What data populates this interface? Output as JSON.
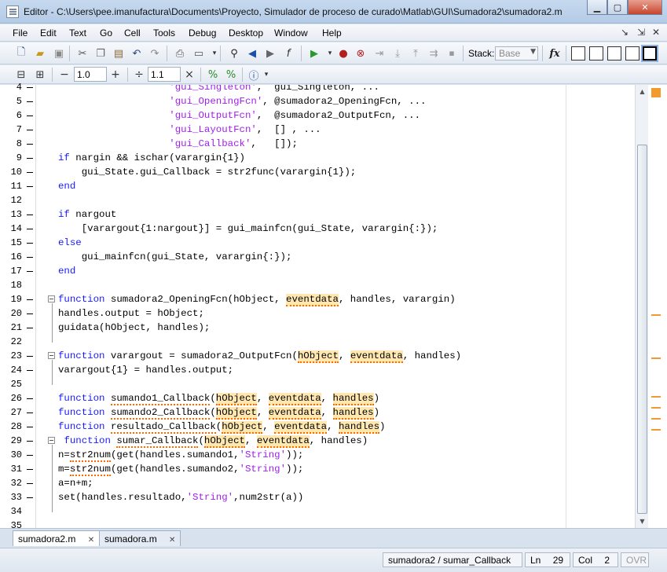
{
  "window": {
    "title": "Editor - C:\\Users\\pee.imanufactura\\Documents\\Proyecto, Simulador de proceso de curado\\Matlab\\GUI\\Sumadora2\\sumadora2.m"
  },
  "menu": [
    "File",
    "Edit",
    "Text",
    "Go",
    "Cell",
    "Tools",
    "Debug",
    "Desktop",
    "Window",
    "Help"
  ],
  "toolbar": {
    "stack_label": "Stack:",
    "stack_value": "Base",
    "cell_field_1": "1.0",
    "cell_field_2": "1.1",
    "minus": "−",
    "plus": "+",
    "divide": "÷",
    "times": "×"
  },
  "code_lines": [
    {
      "n": "4",
      "text": "                   'gui_Singleton',  gui_Singleton, ..."
    },
    {
      "n": "5",
      "text": "                   'gui_OpeningFcn', @sumadora2_OpeningFcn, ..."
    },
    {
      "n": "6",
      "text": "                   'gui_OutputFcn',  @sumadora2_OutputFcn, ..."
    },
    {
      "n": "7",
      "text": "                   'gui_LayoutFcn',  [] , ..."
    },
    {
      "n": "8",
      "text": "                   'gui_Callback',   []);"
    },
    {
      "n": "9",
      "text": "if nargin && ischar(varargin{1})"
    },
    {
      "n": "10",
      "text": "    gui_State.gui_Callback = str2func(varargin{1});"
    },
    {
      "n": "11",
      "text": "end"
    },
    {
      "n": "12",
      "text": ""
    },
    {
      "n": "13",
      "text": "if nargout"
    },
    {
      "n": "14",
      "text": "    [varargout{1:nargout}] = gui_mainfcn(gui_State, varargin{:});"
    },
    {
      "n": "15",
      "text": "else"
    },
    {
      "n": "16",
      "text": "    gui_mainfcn(gui_State, varargin{:});"
    },
    {
      "n": "17",
      "text": "end"
    },
    {
      "n": "18",
      "text": ""
    },
    {
      "n": "19",
      "text": "function sumadora2_OpeningFcn(hObject, eventdata, handles, varargin)"
    },
    {
      "n": "20",
      "text": "handles.output = hObject;"
    },
    {
      "n": "21",
      "text": "guidata(hObject, handles);"
    },
    {
      "n": "22",
      "text": ""
    },
    {
      "n": "23",
      "text": "function varargout = sumadora2_OutputFcn(hObject, eventdata, handles)"
    },
    {
      "n": "24",
      "text": "varargout{1} = handles.output;"
    },
    {
      "n": "25",
      "text": ""
    },
    {
      "n": "26",
      "text": "function sumando1_Callback(hObject, eventdata, handles)"
    },
    {
      "n": "27",
      "text": "function sumando2_Callback(hObject, eventdata, handles)"
    },
    {
      "n": "28",
      "text": "function resultado_Callback(hObject, eventdata, handles)"
    },
    {
      "n": "29",
      "text": " function sumar_Callback(hObject, eventdata, handles)"
    },
    {
      "n": "30",
      "text": "n=str2num(get(handles.sumando1,'String'));"
    },
    {
      "n": "31",
      "text": "m=str2num(get(handles.sumando2,'String'));"
    },
    {
      "n": "32",
      "text": "a=n+m;"
    },
    {
      "n": "33",
      "text": "set(handles.resultado,'String',num2str(a))"
    },
    {
      "n": "34",
      "text": ""
    },
    {
      "n": "35",
      "text": ""
    }
  ],
  "tabs": [
    {
      "label": "sumadora2.m",
      "active": true
    },
    {
      "label": "sumadora.m",
      "active": false
    }
  ],
  "status": {
    "function": "sumadora2 / sumar_Callback",
    "ln_label": "Ln",
    "ln_value": "29",
    "col_label": "Col",
    "col_value": "2",
    "ovr": "OVR"
  },
  "colors": {
    "keyword": "#1a1aff",
    "string": "#a020f0",
    "warning": "#ff6a00",
    "highlight": "#ffe7b0"
  }
}
